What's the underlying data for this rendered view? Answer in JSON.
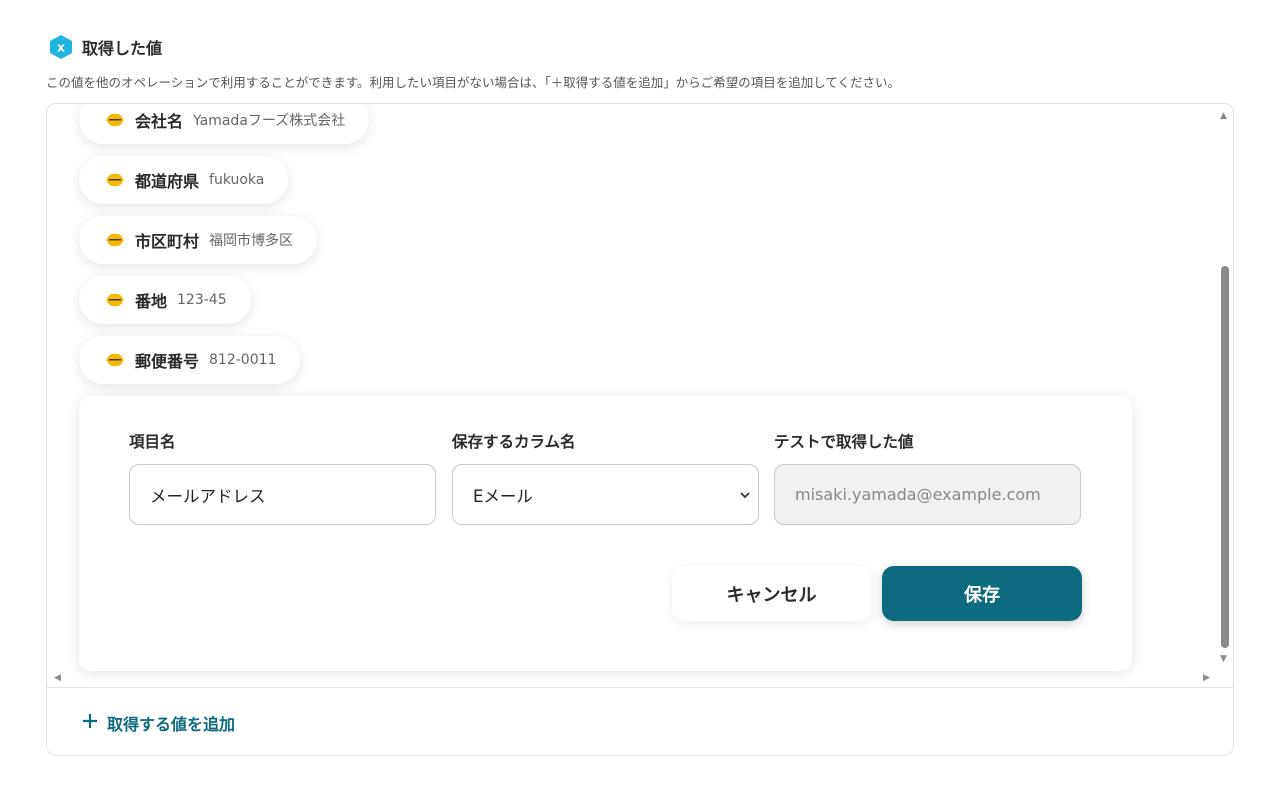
{
  "header": {
    "title": "取得した値",
    "description": "この値を他のオペレーションで利用することができます。利用したい項目がない場合は、「＋取得する値を追加」からご希望の項目を追加してください。"
  },
  "items": [
    {
      "name": "会社名",
      "value": "Yamadaフーズ株式会社"
    },
    {
      "name": "都道府県",
      "value": "fukuoka"
    },
    {
      "name": "市区町村",
      "value": "福岡市博多区"
    },
    {
      "name": "番地",
      "value": "123-45"
    },
    {
      "name": "郵便番号",
      "value": "812-0011"
    }
  ],
  "form": {
    "item_name_label": "項目名",
    "item_name_value": "メールアドレス",
    "column_label": "保存するカラム名",
    "column_value": "Eメール",
    "test_value_label": "テストで取得した値",
    "test_value": "misaki.yamada@example.com",
    "cancel_label": "キャンセル",
    "save_label": "保存"
  },
  "footer": {
    "add_label": "取得する値を追加"
  },
  "colors": {
    "accent": "#0d6a7f",
    "badge": "#1fb5e0",
    "app_logo": "#f6b800"
  },
  "icons": {
    "header_badge": "variable-x-icon",
    "item_logo": "kintone-logo-icon",
    "add": "plus-icon"
  }
}
